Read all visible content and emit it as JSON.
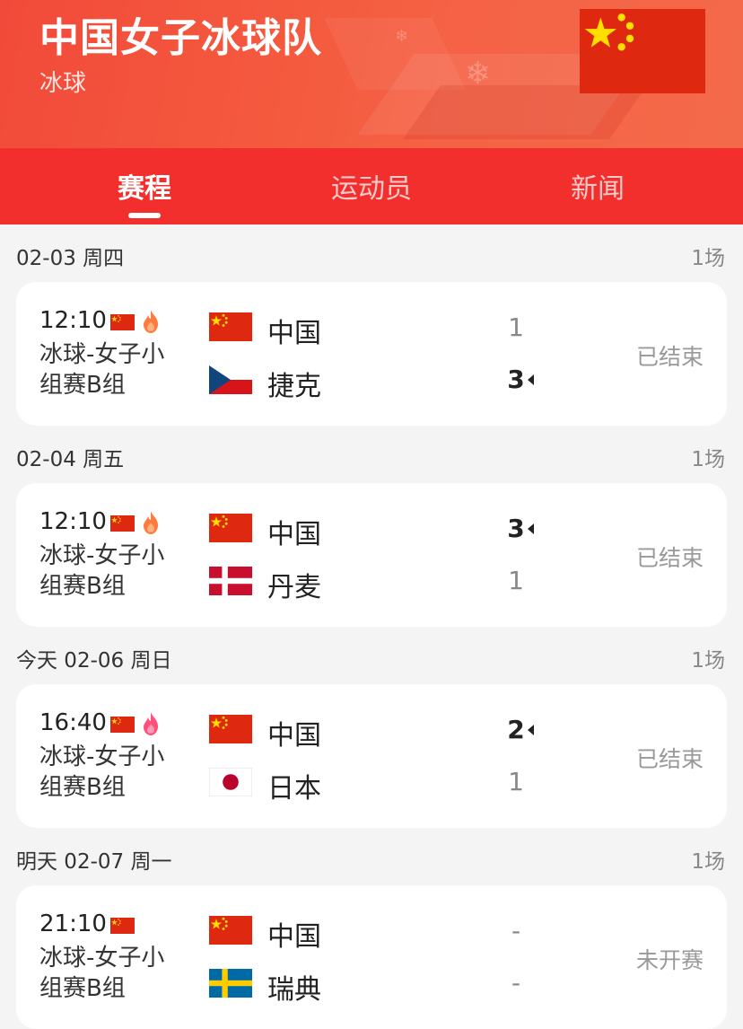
{
  "header": {
    "title": "中国女子冰球队",
    "subtitle": "冰球",
    "flag_icon": "china-flag-icon",
    "bg_color": "#f24a3a"
  },
  "tabs": [
    {
      "label": "赛程",
      "active": true
    },
    {
      "label": "运动员",
      "active": false
    },
    {
      "label": "新闻",
      "active": false
    }
  ],
  "days": [
    {
      "date": "02-03 周四",
      "count": "1场",
      "match": {
        "time": "12:10",
        "hot": "fire-icon-orange",
        "event_line1": "冰球-女子小",
        "event_line2": "组赛B组",
        "home": {
          "name": "中国",
          "flag": "china-flag-icon",
          "score": "1",
          "winner": false
        },
        "away": {
          "name": "捷克",
          "flag": "czech-flag-icon",
          "score": "3",
          "winner": true
        },
        "status": "已结束"
      }
    },
    {
      "date": "02-04 周五",
      "count": "1场",
      "match": {
        "time": "12:10",
        "hot": "fire-icon-orange",
        "event_line1": "冰球-女子小",
        "event_line2": "组赛B组",
        "home": {
          "name": "中国",
          "flag": "china-flag-icon",
          "score": "3",
          "winner": true
        },
        "away": {
          "name": "丹麦",
          "flag": "denmark-flag-icon",
          "score": "1",
          "winner": false
        },
        "status": "已结束"
      }
    },
    {
      "date": "今天 02-06 周日",
      "count": "1场",
      "match": {
        "time": "16:40",
        "hot": "fire-icon-pink",
        "event_line1": "冰球-女子小",
        "event_line2": "组赛B组",
        "home": {
          "name": "中国",
          "flag": "china-flag-icon",
          "score": "2",
          "winner": true
        },
        "away": {
          "name": "日本",
          "flag": "japan-flag-icon",
          "score": "1",
          "winner": false
        },
        "status": "已结束"
      }
    },
    {
      "date": "明天 02-07 周一",
      "count": "1场",
      "match": {
        "time": "21:10",
        "hot": "",
        "event_line1": "冰球-女子小",
        "event_line2": "组赛B组",
        "home": {
          "name": "中国",
          "flag": "china-flag-icon",
          "score": "-",
          "winner": false
        },
        "away": {
          "name": "瑞典",
          "flag": "sweden-flag-icon",
          "score": "-",
          "winner": false
        },
        "status": "未开赛"
      }
    }
  ]
}
